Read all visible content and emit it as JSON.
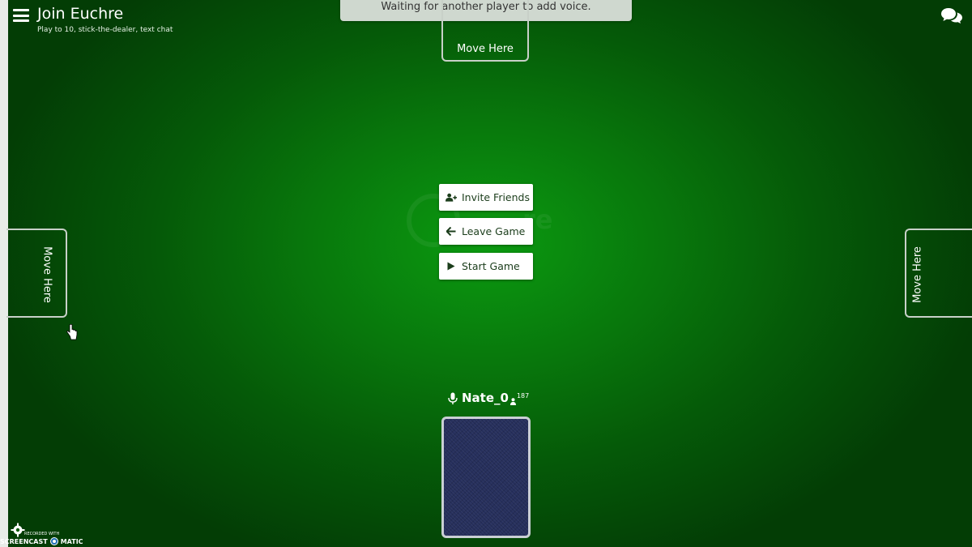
{
  "header": {
    "title": "Join Euchre",
    "subtitle": "Play to 10, stick-the-dealer, text chat",
    "menu_icon": "hamburger-menu-icon",
    "chat_icon": "chat-bubbles-icon"
  },
  "banner": {
    "text": "Waiting for another player to add voice."
  },
  "seats": {
    "top_label": "Move Here",
    "left_label": "Move Here",
    "right_label": "Move Here"
  },
  "actions": {
    "invite_label": "Invite Friends",
    "invite_icon": "add-user-icon",
    "leave_label": "Leave Game",
    "leave_icon": "arrow-left-icon",
    "start_label": "Start Game",
    "start_icon": "play-icon"
  },
  "player": {
    "name": "Nate_0",
    "score": "187",
    "mic_icon": "microphone-icon",
    "score_icon": "person-icon"
  },
  "watermark": {
    "brand_left": "SCREENCAST",
    "brand_right": "MATIC",
    "recorded_with": "RECORDED WITH"
  },
  "colors": {
    "felt": "#0b9a10",
    "card_back": "#262f5c",
    "button_text": "#1b3d1b"
  }
}
